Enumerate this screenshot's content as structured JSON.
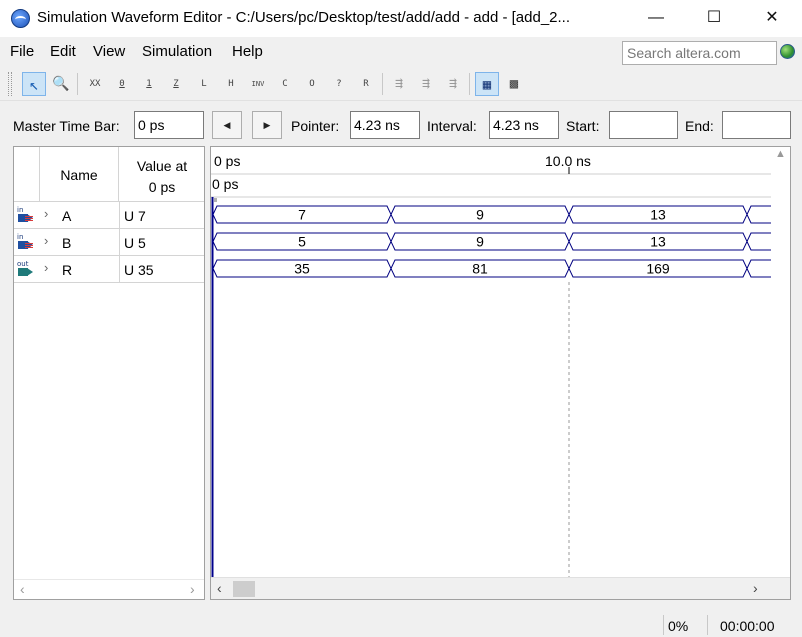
{
  "window": {
    "title": "Simulation Waveform Editor - C:/Users/pc/Desktop/test/add/add - add - [add_2...",
    "minimize": "—",
    "maximize": "☐",
    "close": "✕"
  },
  "menu": {
    "items": [
      "File",
      "Edit",
      "View",
      "Simulation",
      "Help"
    ],
    "search_placeholder": "Search altera.com"
  },
  "toolbar": {
    "buttons": [
      {
        "icon": "selection-tool-icon",
        "glyph": "↖"
      },
      {
        "icon": "zoom-tool-icon",
        "glyph": "🔍"
      },
      {
        "icon": "forcing-unknown-icon",
        "glyph": "XX"
      },
      {
        "icon": "forcing-low-icon",
        "glyph": "0"
      },
      {
        "icon": "forcing-high-icon",
        "glyph": "1"
      },
      {
        "icon": "high-impedance-icon",
        "glyph": "Z"
      },
      {
        "icon": "weak-low-icon",
        "glyph": "L"
      },
      {
        "icon": "weak-high-icon",
        "glyph": "H"
      },
      {
        "icon": "invert-icon",
        "glyph": "INV"
      },
      {
        "icon": "count-value-icon",
        "glyph": "C"
      },
      {
        "icon": "overwrite-clock-icon",
        "glyph": "O"
      },
      {
        "icon": "arbitrary-value-icon",
        "glyph": "?"
      },
      {
        "icon": "random-values-icon",
        "glyph": "R"
      },
      {
        "icon": "snap-to-grid-icon",
        "glyph": "⇶"
      },
      {
        "icon": "move-grid-icon",
        "glyph": "⇶"
      },
      {
        "icon": "reveal-icon",
        "glyph": "⇶"
      },
      {
        "icon": "grid-settings-icon",
        "glyph": "▦"
      },
      {
        "icon": "waveform-display-icon",
        "glyph": "▩"
      }
    ]
  },
  "timebar": {
    "master_label": "Master Time Bar:",
    "master_value": "0 ps",
    "prev_glyph": "◀",
    "next_glyph": "▶",
    "pointer_label": "Pointer:",
    "pointer_value": "4.23 ns",
    "interval_label": "Interval:",
    "interval_value": "4.23 ns",
    "start_label": "Start:",
    "start_value": "",
    "end_label": "End:",
    "end_value": ""
  },
  "signal_table": {
    "name_header": "Name",
    "value_header_line1": "Value at",
    "value_header_line2": "0 ps",
    "signals": [
      {
        "direction": "in",
        "name": "A",
        "value": "U 7"
      },
      {
        "direction": "in",
        "name": "B",
        "value": "U 5"
      },
      {
        "direction": "out",
        "name": "R",
        "value": "U 35"
      }
    ]
  },
  "waveform": {
    "time_start": "0 ps",
    "time_mid": "10.0 ns",
    "marker_label": "0 ps",
    "rows": [
      {
        "signal": "A",
        "values": [
          "7",
          "9",
          "13"
        ]
      },
      {
        "signal": "B",
        "values": [
          "5",
          "9",
          "13"
        ]
      },
      {
        "signal": "R",
        "values": [
          "35",
          "81",
          "169"
        ]
      }
    ]
  },
  "status": {
    "progress": "0%",
    "elapsed": "00:00:00"
  },
  "colors": {
    "waveform_line": "#000080",
    "cursor": "#00008b"
  }
}
